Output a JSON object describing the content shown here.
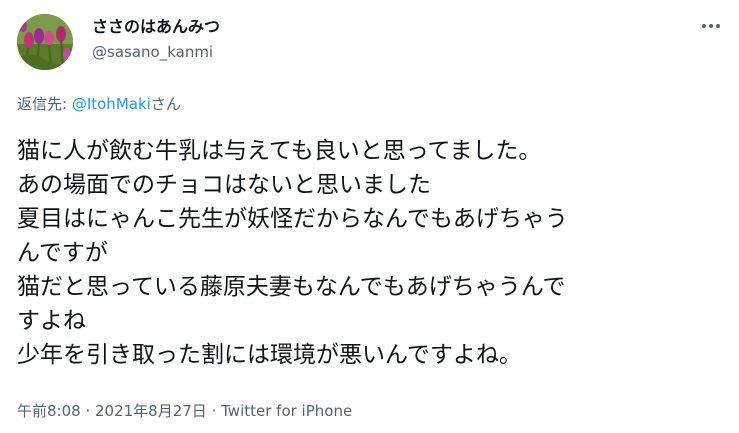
{
  "user": {
    "display_name": "ささのはあんみつ",
    "handle": "@sasano_kanmi"
  },
  "reply": {
    "prefix": "返信先: ",
    "mention": "@ItohMaki",
    "suffix": "さん"
  },
  "tweet_lines": [
    "猫に人が飲む牛乳は与えても良いと思ってました。",
    "あの場面でのチョコはないと思いました",
    "夏目はにゃんこ先生が妖怪だからなんでもあげちゃう",
    "んですが",
    "猫だと思っている藤原夫妻もなんでもあげちゃうんで",
    "すよね",
    "少年を引き取った割には環境が悪いんですよね。"
  ],
  "meta": {
    "time": "午前8:08",
    "separator": " · ",
    "date": "2021年8月27日",
    "source": "Twitter for iPhone"
  },
  "icons": {
    "avatar": "tulip-flowers-avatar",
    "more": "more-options-icon"
  },
  "colors": {
    "text_primary": "#0f1419",
    "text_secondary": "#536471",
    "link": "#1d9bf0"
  }
}
